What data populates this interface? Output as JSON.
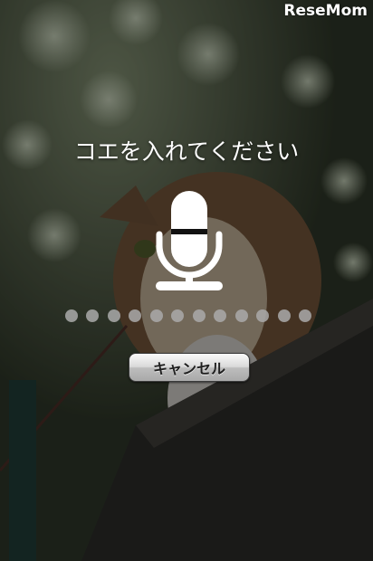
{
  "watermark": "ReseMom",
  "voice_prompt": {
    "title": "コエを入れてください",
    "icon": "microphone-icon",
    "level_dots": 12,
    "cancel_label": "キャンセル"
  },
  "colors": {
    "text": "#ffffff",
    "dot": "#aaaaaa",
    "button_text": "#202020"
  }
}
